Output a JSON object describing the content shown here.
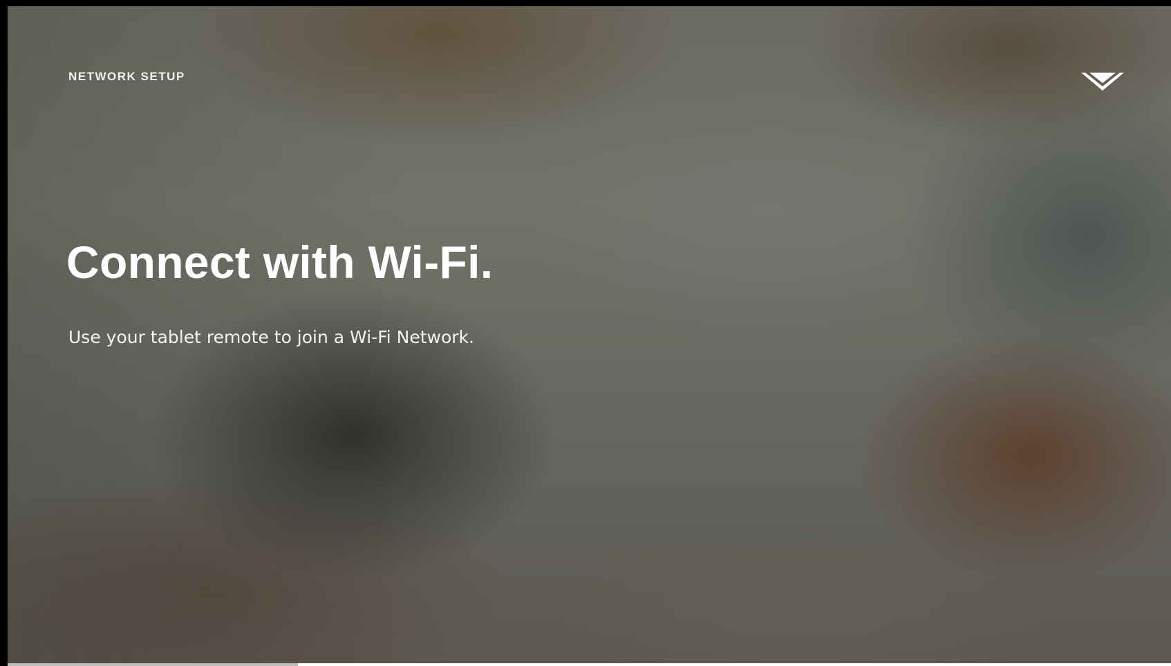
{
  "screen": {
    "eyebrow": "NETWORK SETUP",
    "title": "Connect with Wi-Fi.",
    "subtitle": "Use your tablet remote to join a Wi-Fi Network."
  },
  "brand": {
    "logo_icon": "vizio-v-chevron-icon"
  },
  "colors": {
    "text": "#ffffff",
    "frame_border": "#000000"
  }
}
